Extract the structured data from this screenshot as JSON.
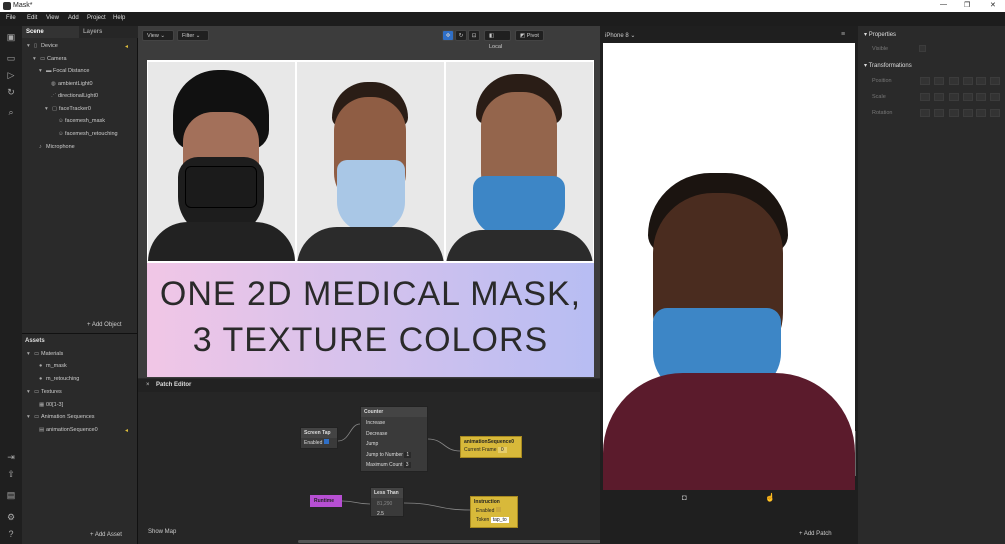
{
  "window": {
    "title": "Mask*",
    "controls": [
      "—",
      "❐",
      "✕"
    ]
  },
  "menu": [
    "File",
    "Edit",
    "View",
    "Add",
    "Project",
    "Help"
  ],
  "scene": {
    "tabs": [
      "Scene",
      "Layers"
    ],
    "tree": [
      "Device",
      "Camera",
      "Focal Distance",
      "ambientLight0",
      "directionalLight0",
      "faceTracker0",
      "facemesh_mask",
      "facemesh_retouching",
      "Microphone"
    ],
    "add_object": "Add Object",
    "assets_title": "Assets",
    "assets": [
      "Materials",
      "m_mask",
      "m_retouching",
      "Textures",
      "00[1-3]",
      "Animation Sequences",
      "animationSequence0"
    ],
    "add_asset": "Add Asset"
  },
  "viewport": {
    "view": "View",
    "filter": "Filter",
    "local": "Local",
    "pivot": "Pivot",
    "banner_line1": "ONE 2D MEDICAL MASK,",
    "banner_line2": "3 TEXTURE COLORS"
  },
  "patch": {
    "title": "Patch Editor",
    "screen_tap": "Screen Tap",
    "enabled": "Enabled",
    "counter": "Counter",
    "increase": "Increase",
    "decrease": "Decrease",
    "jump": "Jump",
    "jump_to_number": "Jump to Number",
    "jump_val": "1",
    "maximum_count": "Maximum Count",
    "max_val": "3",
    "anim_seq": "animationSequence0",
    "current_frame": "Current Frame",
    "current_frame_val": "0",
    "runtime": "Runtime",
    "less_than": "Less Than",
    "lt_val1": "81,290",
    "lt_val2": "2.5",
    "instruction": "Instruction",
    "token": "Token",
    "token_val": "tap_to",
    "show_map": "Show Map",
    "add_patch": "Add Patch"
  },
  "device": {
    "name": "iPhone 8"
  },
  "properties": {
    "title": "Properties",
    "visible": "Visible",
    "transformations": "Transformations",
    "position": "Position",
    "scale": "Scale",
    "rotation": "Rotation"
  },
  "colors": {
    "mask_black": "#1b1b1b",
    "mask_light_blue": "#a9c7e6",
    "mask_blue": "#3d86c6",
    "runtime": "#b74fd3",
    "yellow_node": "#d8b93a"
  }
}
